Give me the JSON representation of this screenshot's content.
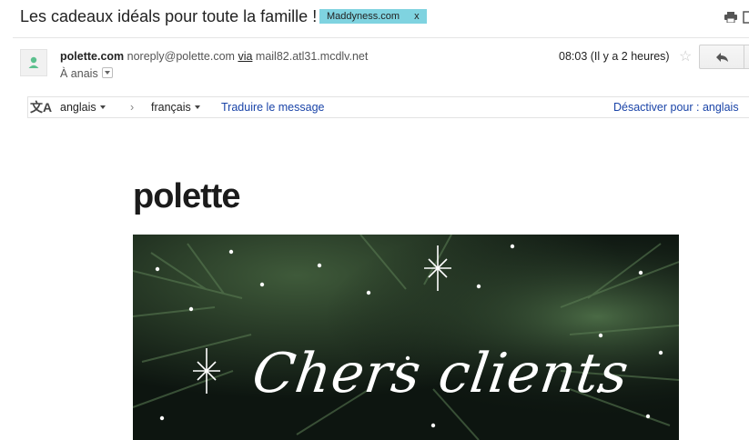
{
  "email": {
    "subject": "Les cadeaux idéals pour toute la famille !",
    "label": "Maddyness.com",
    "label_remove": "x",
    "sender_name": "polette.com",
    "sender_email": "noreply@polette.com",
    "via_label": "via",
    "via_host": "mail82.atl31.mcdlv.net",
    "to_line": "À anais",
    "time": "08:03 (Il y a 2 heures)"
  },
  "translate": {
    "from_lang": "anglais",
    "arrow": "›",
    "to_lang": "français",
    "translate_link": "Traduire le message",
    "disable_link": "Désactiver pour : anglais"
  },
  "body": {
    "brand_logo": "polette",
    "hero_text": "Chers clients"
  },
  "icons": {
    "print": "print-icon",
    "open_new": "open-in-new-window-icon",
    "avatar": "person-icon",
    "star": "star-icon",
    "reply": "reply-icon",
    "translate": "translate-icon"
  },
  "colors": {
    "label_bg": "#7fd3e0",
    "link": "#1a44a8",
    "hero_bg": "#0f1a12"
  }
}
